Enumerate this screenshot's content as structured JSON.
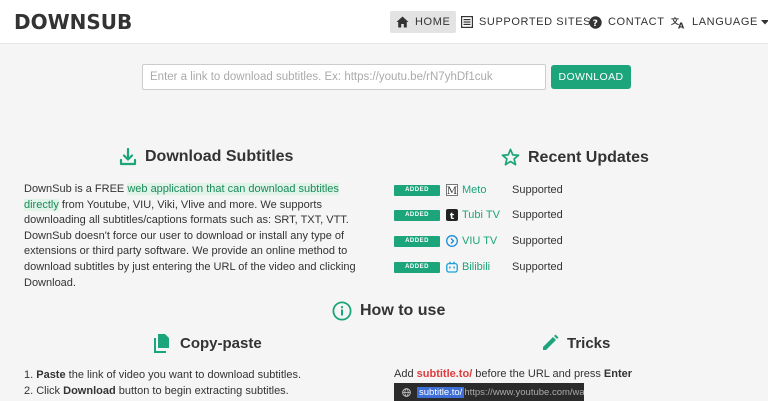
{
  "brand": {
    "logo_text_a": "DOWN",
    "logo_text_b": "SUB"
  },
  "nav": {
    "home": "HOME",
    "supported": "SUPPORTED SITES",
    "contact": "CONTACT",
    "language": "LANGUAGE"
  },
  "search": {
    "placeholder": "Enter a link to download subtitles. Ex: https://youtu.be/rN7yhDf1cuk",
    "value": "",
    "button": "DOWNLOAD"
  },
  "download_section": {
    "title": "Download Subtitles",
    "p1_a": "DownSub is a FREE ",
    "p1_hl": "web application that can download subtitles directly",
    "p1_b": " from Youtube, VIU, Viki, Vlive and more. We supports downloading all subtitles/captions formats such as: SRT, TXT, VTT.",
    "p2": "DownSub doesn't force our user to download or install any type of extensions or third party software. We provide an online method to download subtitles by just entering the URL of the video and clicking Download."
  },
  "updates_section": {
    "title": "Recent Updates",
    "items": [
      {
        "badge": "ADDED",
        "site": "Meto",
        "status": "Supported",
        "icon": "m-logo-icon"
      },
      {
        "badge": "ADDED",
        "site": "Tubi TV",
        "status": "Supported",
        "icon": "tubi-icon"
      },
      {
        "badge": "ADDED",
        "site": "VIU TV",
        "status": "Supported",
        "icon": "viu-icon"
      },
      {
        "badge": "ADDED",
        "site": "Bilibili",
        "status": "Supported",
        "icon": "bilibili-icon"
      }
    ]
  },
  "how_to": {
    "title": "How to use",
    "copy_paste_title": "Copy-paste",
    "steps": [
      {
        "num": "1. ",
        "bold": "Paste",
        "rest": " the link of video you want to download subtitles."
      },
      {
        "num": "2. Click ",
        "bold": "Download",
        "rest": " button to begin extracting subtitles."
      }
    ],
    "tricks_title": "Tricks",
    "tricks_a": "Add ",
    "tricks_b": "subtitle.to/",
    "tricks_c": " before the URL and press ",
    "tricks_d": "Enter",
    "demo_hl": "subtitle.to/",
    "demo_rest": "https://www.youtube.com/watc"
  },
  "colors": {
    "accent": "#1ca57a",
    "red": "#e03c3c"
  }
}
